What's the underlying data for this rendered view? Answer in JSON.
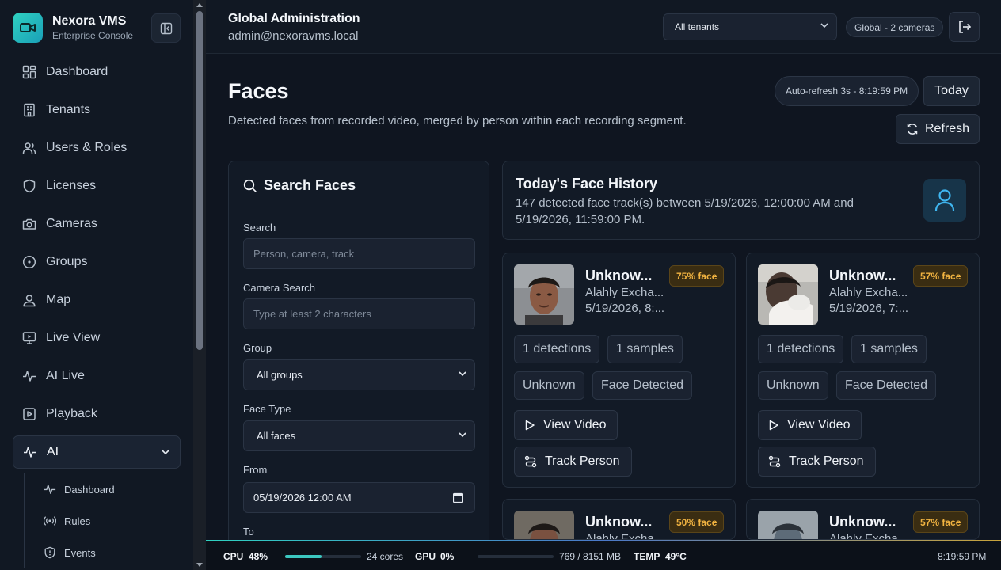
{
  "brand": {
    "name": "Nexora VMS",
    "subtitle": "Enterprise Console"
  },
  "sidebar": {
    "items": [
      {
        "label": "Dashboard",
        "icon": "dashboard-icon"
      },
      {
        "label": "Tenants",
        "icon": "building-icon"
      },
      {
        "label": "Users & Roles",
        "icon": "users-icon"
      },
      {
        "label": "Licenses",
        "icon": "shield-icon"
      },
      {
        "label": "Cameras",
        "icon": "camera-icon"
      },
      {
        "label": "Groups",
        "icon": "target-icon"
      },
      {
        "label": "Map",
        "icon": "map-pin-icon"
      },
      {
        "label": "Live View",
        "icon": "monitor-icon"
      },
      {
        "label": "AI Live",
        "icon": "activity-icon"
      },
      {
        "label": "Playback",
        "icon": "play-square-icon"
      },
      {
        "label": "AI",
        "icon": "activity-icon",
        "expanded": true
      }
    ],
    "subitems": [
      {
        "label": "Dashboard",
        "icon": "activity-icon"
      },
      {
        "label": "Rules",
        "icon": "broadcast-icon"
      },
      {
        "label": "Events",
        "icon": "shield-alert-icon"
      }
    ]
  },
  "header": {
    "title": "Global Administration",
    "user": "admin@nexoravms.local",
    "tenant_select": "All tenants",
    "scope_badge": "Global - 2 cameras"
  },
  "page": {
    "title": "Faces",
    "description": "Detected faces from recorded video, merged by person within each recording segment.",
    "auto_refresh": "Auto-refresh 3s - 8:19:59 PM",
    "today_label": "Today",
    "refresh_label": "Refresh"
  },
  "search": {
    "title": "Search Faces",
    "search_label": "Search",
    "search_placeholder": "Person, camera, track",
    "camera_label": "Camera Search",
    "camera_placeholder": "Type at least 2 characters",
    "group_label": "Group",
    "group_value": "All groups",
    "face_type_label": "Face Type",
    "face_type_value": "All faces",
    "from_label": "From",
    "from_value": "05/19/2026 12:00 AM",
    "to_label": "To"
  },
  "history": {
    "title": "Today's Face History",
    "description": "147 detected face track(s) between 5/19/2026, 12:00:00 AM and 5/19/2026, 11:59:00 PM."
  },
  "cards": [
    {
      "name": "Unknow...",
      "location": "Alahly Excha...",
      "time": "5/19/2026, 8:...",
      "confidence": "75% face",
      "detections": "1 detections",
      "samples": "1 samples",
      "identity": "Unknown",
      "status": "Face Detected",
      "view_label": "View Video",
      "track_label": "Track Person"
    },
    {
      "name": "Unknow...",
      "location": "Alahly Excha...",
      "time": "5/19/2026, 7:...",
      "confidence": "57% face",
      "detections": "1 detections",
      "samples": "1 samples",
      "identity": "Unknown",
      "status": "Face Detected",
      "view_label": "View Video",
      "track_label": "Track Person"
    },
    {
      "name": "Unknow...",
      "location": "Alahly Excha...",
      "time": "",
      "confidence": "50% face"
    },
    {
      "name": "Unknow...",
      "location": "Alahly Excha...",
      "time": "",
      "confidence": "57% face"
    }
  ],
  "status_bar": {
    "cpu_label": "CPU",
    "cpu_value": "48%",
    "cpu_fraction": 0.48,
    "cores": "24 cores",
    "gpu_label": "GPU",
    "gpu_value": "0%",
    "gpu_fraction": 0.0,
    "memory": "769 / 8151 MB",
    "temp_label": "TEMP",
    "temp_value": "49°C",
    "clock": "8:19:59 PM"
  },
  "colors": {
    "accent": "#2fd1c0",
    "warning_badge": "#f2b441",
    "background": "#0f1520"
  }
}
